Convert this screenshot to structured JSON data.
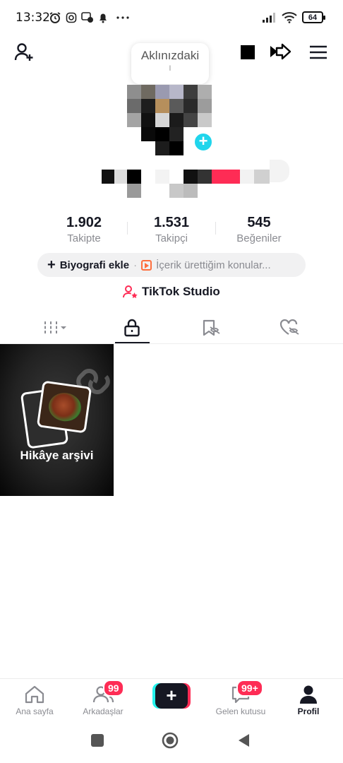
{
  "status_bar": {
    "time": "13:32",
    "battery": "64"
  },
  "header": {
    "tooltip_text": "Aklınızdaki"
  },
  "stats": [
    {
      "value": "1.902",
      "label": "Takipte"
    },
    {
      "value": "1.531",
      "label": "Takipçi"
    },
    {
      "value": "545",
      "label": "Beğeniler"
    }
  ],
  "bio": {
    "add_label": "Biyografi ekle",
    "separator": "·",
    "topic_label": "İçerik ürettiğim konular..."
  },
  "studio": {
    "label": "TikTok Studio"
  },
  "tabs": [
    {
      "icon": "grid-icon",
      "active": false
    },
    {
      "icon": "lock-icon",
      "active": true
    },
    {
      "icon": "tag-icon",
      "active": false
    },
    {
      "icon": "heart-hidden-icon",
      "active": false
    }
  ],
  "grid": {
    "tile_label": "Hikâye arşivi"
  },
  "bottom_nav": {
    "home": "Ana sayfa",
    "friends": "Arkadaşlar",
    "friends_badge": "99",
    "inbox": "Gelen kutusu",
    "inbox_badge": "99+",
    "profile": "Profil"
  },
  "colors": {
    "accent_red": "#fe2c55",
    "accent_cyan": "#25f4ee",
    "avatar_plus": "#20d5ec"
  }
}
